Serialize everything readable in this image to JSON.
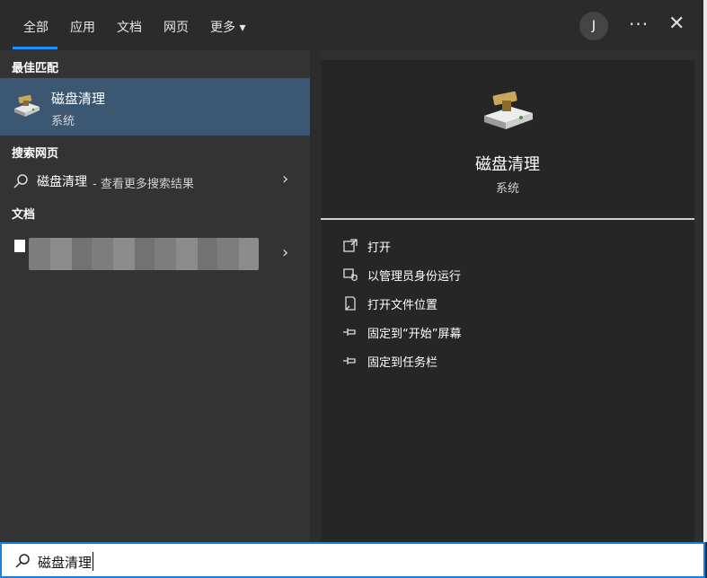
{
  "tabs": [
    {
      "label": "全部",
      "active": true
    },
    {
      "label": "应用"
    },
    {
      "label": "文档"
    },
    {
      "label": "网页"
    },
    {
      "label": "更多 ▾"
    }
  ],
  "avatar_initial": "J",
  "more_glyph": "···",
  "close_glyph": "✕",
  "sections": {
    "best_match": "最佳匹配",
    "search_web": "搜索网页",
    "documents": "文档"
  },
  "best_match": {
    "title": "磁盘清理",
    "subtitle": "系统",
    "icon": "disk-cleanup-icon"
  },
  "web_result": {
    "label": "磁盘清理",
    "suffix": "- 查看更多搜索结果"
  },
  "chevron": "›",
  "detail": {
    "title": "磁盘清理",
    "subtitle": "系统",
    "actions": [
      {
        "label": "打开",
        "icon": "open-icon"
      },
      {
        "label": "以管理员身份运行",
        "icon": "shield-icon"
      },
      {
        "label": "打开文件位置",
        "icon": "file-location-icon"
      },
      {
        "label": "固定到“开始”屏幕",
        "icon": "pin-icon"
      },
      {
        "label": "固定到任务栏",
        "icon": "pin-icon"
      }
    ]
  },
  "search": {
    "query": "磁盘清理"
  },
  "colors": {
    "accent": "#1e90ff",
    "selected": "#3b5772"
  }
}
